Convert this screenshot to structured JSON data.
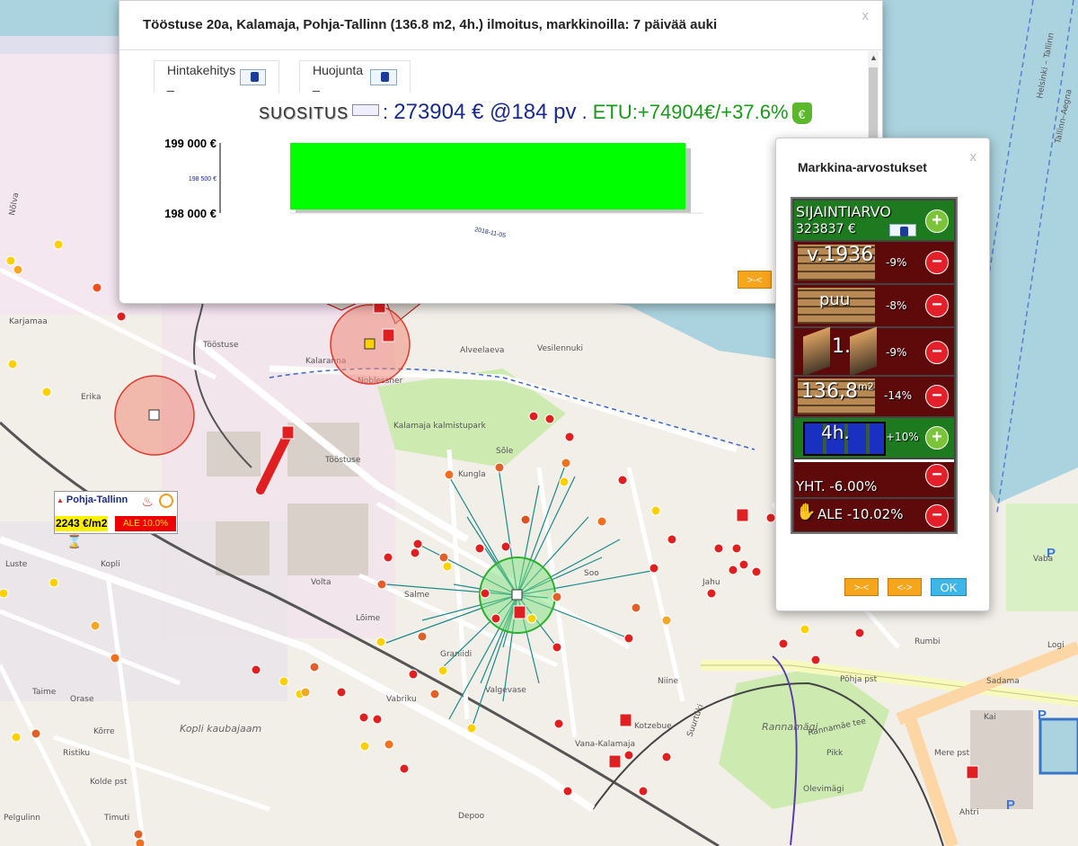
{
  "popup": {
    "title": "Tööstuse 20a, Kalamaja, Pohja-Tallinn (136.8 m2, 4h.) ilmoitus, markkinoilla: 7 päivää auki",
    "close": "x",
    "tabs": [
      "Hintakehitys _",
      "Huojunta _"
    ],
    "suositus_label": "SUOSITUS",
    "price": "273904 € @184 pv",
    "sep": " . ",
    "etu": "ETU:+74904€/+37.6%",
    "bag_icon": "€",
    "nav_button": ">-<"
  },
  "chart_data": {
    "type": "bar",
    "categories": [
      "2018-11-05"
    ],
    "values": [
      199000
    ],
    "yticks": [
      "199 000 €",
      "198 500 €",
      "198 000 €"
    ],
    "ylim": [
      198000,
      199000
    ],
    "bar_color": "#00ff00"
  },
  "map": {
    "labels": [
      "Karjamaa",
      "Noblessner",
      "Kalamaja kalmistupark",
      "Kopli kaubajaam",
      "Pelgulinn",
      "Rannamägi",
      "Depoo",
      "Tööstuse",
      "Kalaranna",
      "Vesilennuki",
      "Alveelaeva",
      "Põhja pst",
      "Sadama",
      "Niine",
      "Kotzebue",
      "Kopli",
      "Rumbi",
      "Kai",
      "Ahtri",
      "Mere pst",
      "Logi",
      "Luste",
      "Taime",
      "Orase",
      "Kõrre",
      "Ristiku",
      "Tööstuse",
      "Sõle",
      "Volta",
      "Salme",
      "Graniidi",
      "Vabriku",
      "Lõime",
      "Valgevase",
      "Vana-Kalamaja",
      "Soo",
      "Jahu",
      "Vaba",
      "Kungla",
      "Kolde pst",
      "Timuti",
      "Helsinki – Tallinn",
      "Tallinn–Aegna",
      "Rannamäe tee",
      "Suurtüki",
      "Olevimägi",
      "Pikk",
      "Erika",
      "Nõlva"
    ],
    "parking": "P"
  },
  "district_box": {
    "name": "Pohja-Tallinn",
    "ppm2": "2243 €/m2",
    "ale": "ALE 10.0%",
    "hourglass": "⌛"
  },
  "market": {
    "title": "Markkina-arvostukset",
    "close": "x",
    "rows": [
      {
        "label": "SIJAINTIARVO",
        "sub": "323837 €",
        "sign": "+"
      },
      {
        "label": "v.1936",
        "pct": "-9%",
        "sign": "−"
      },
      {
        "label": "puu",
        "pct": "-8%",
        "sign": "−"
      },
      {
        "label": "1.",
        "pct": "-9%",
        "sign": "−"
      },
      {
        "label": "136,8",
        "sup": "m2",
        "pct": "-14%",
        "sign": "−"
      },
      {
        "label": "4h.",
        "pct": "+10%",
        "sign": "+"
      },
      {
        "label": "YHT. -6.00%",
        "sign": "−"
      },
      {
        "label": "ALE -10.02%",
        "sign": "−"
      }
    ],
    "buttons": [
      ">-<",
      "<->",
      "OK"
    ]
  },
  "colors": {
    "accent_green": "#1e7a1e",
    "accent_red": "#5e0a0a",
    "price_blue": "#1a2a8a",
    "etu_green": "#1a9a1a",
    "ok_blue": "#3fb6e8",
    "orange_btn": "#f6a51c"
  }
}
